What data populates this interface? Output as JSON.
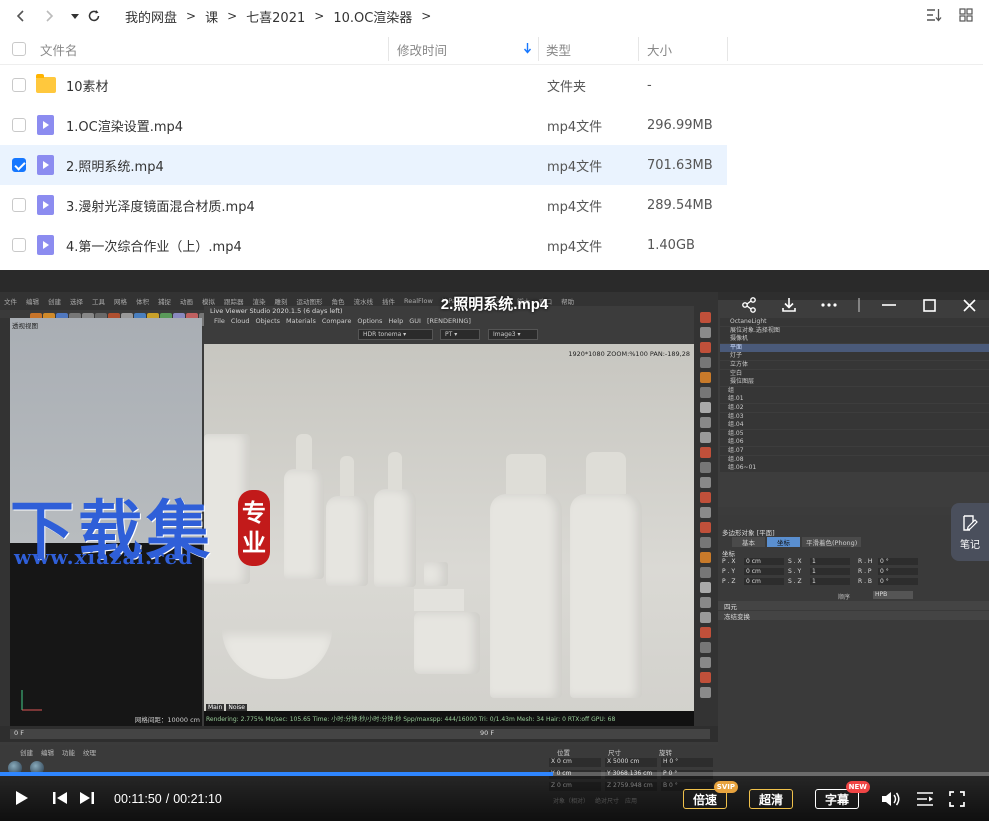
{
  "browser": {
    "breadcrumb": [
      "我的网盘",
      "课",
      "七喜2021",
      "10.OC渲染器"
    ],
    "columns": {
      "name": "文件名",
      "modified": "修改时间",
      "type": "类型",
      "size": "大小"
    },
    "files": [
      {
        "name": "10素材",
        "type": "文件夹",
        "size": "-",
        "icon": "folder-icon",
        "checked": false
      },
      {
        "name": "1.OC渲染设置.mp4",
        "type": "mp4文件",
        "size": "296.99MB",
        "icon": "video-file-icon",
        "checked": false
      },
      {
        "name": "2.照明系统.mp4",
        "type": "mp4文件",
        "size": "701.63MB",
        "icon": "video-file-icon",
        "checked": true
      },
      {
        "name": "3.漫射光泽度镜面混合材质.mp4",
        "type": "mp4文件",
        "size": "289.54MB",
        "icon": "video-file-icon",
        "checked": false
      },
      {
        "name": "4.第一次综合作业（上）.mp4",
        "type": "mp4文件",
        "size": "1.40GB",
        "icon": "video-file-icon",
        "checked": false
      }
    ]
  },
  "player": {
    "title": "2.照明系统.mp4",
    "current_time": "00:11:50",
    "total_time": "00:21:10",
    "progress_fraction": 0.5591,
    "speed_label": "倍速",
    "speed_badge": "SVIP",
    "quality_label": "超清",
    "subtitle_label": "字幕",
    "subtitle_badge": "NEW",
    "note_label": "笔记",
    "accent": "#2f86ff"
  },
  "c4d": {
    "menu": [
      "文件",
      "编辑",
      "创建",
      "选择",
      "工具",
      "网格",
      "体积",
      "捕捉",
      "动画",
      "模拟",
      "跟踪器",
      "渲染",
      "雕刻",
      "运动图形",
      "角色",
      "流水线",
      "插件",
      "RealFlow",
      "X-Particles",
      "Octane",
      "脚本",
      "窗口",
      "帮助"
    ],
    "viewport_label": "透视视图",
    "viewport_footer": "网格间距：10000 cm",
    "render_window_title": "Live Viewer Studio 2020.1.5 (6 days left)",
    "render_menu": [
      "File",
      "Cloud",
      "Objects",
      "Materials",
      "Compare",
      "Options",
      "Help",
      "GUI",
      "[RENDERING]"
    ],
    "render_info": "1920*1080 ZOOM:%100  PAN:-189,28",
    "render_status": "Rendering: 2.775%  Ms/sec: 105.65   Time: 小时:分钟:秒/小时:分钟:秒   Spp/maxspp: 444/16000  Tri: 0/1.43m   Mesh: 34   Hair: 0   RTX:off     GPU: 68",
    "render_tabs": [
      "Main",
      "Noise"
    ],
    "objects": [
      "OctaneLight",
      "展位对象.选择视图",
      "摄像机",
      "平面",
      "灯子",
      "立方体",
      "空白",
      "摄位图层",
      "组",
      "组.01",
      "组.02",
      "组.03",
      "组.04",
      "组.05",
      "组.06",
      "组.07",
      "组.08",
      "组.06~01"
    ],
    "attr_title": "多边形对象 [平面]",
    "attr_tabs": [
      "基本",
      "坐标",
      "平滑着色(Phong)"
    ],
    "coords_title": "坐标",
    "coords": [
      {
        "axis": "P . X",
        "value": "0 cm",
        "s": "S . X",
        "sval": "1",
        "r": "R . H",
        "rval": "0 °"
      },
      {
        "axis": "P . Y",
        "value": "0 cm",
        "s": "S . Y",
        "sval": "1",
        "r": "R . P",
        "rval": "0 °"
      },
      {
        "axis": "P . Z",
        "value": "0 cm",
        "s": "S . Z",
        "sval": "1",
        "r": "R . B",
        "rval": "0 °"
      }
    ],
    "order_label": "顺序",
    "order_value": "HPB",
    "quat_label": "四元",
    "freeze_label": "冻结变换",
    "timeline_start": "0 F",
    "timeline_end": "90 F",
    "mat_menu": [
      "创建",
      "编辑",
      "功能",
      "纹理"
    ],
    "xform_headers": [
      "位置",
      "尺寸",
      "旋转"
    ],
    "xform_rows": [
      {
        "pos": "X 0 cm",
        "size": "X 5000 cm",
        "rot": "H 0 °"
      },
      {
        "pos": "Y 0 cm",
        "size": "Y 3068.136 cm",
        "rot": "P 0 °"
      },
      {
        "pos": "Z 0 cm",
        "size": "Z 2759.948 cm",
        "rot": "B 0 °"
      }
    ],
    "xform_footer": [
      "对象（相对）",
      "绝对尺寸",
      "应用"
    ]
  },
  "watermark": {
    "big_text": "下载集",
    "url": "www.xiazai.red",
    "seal_text": [
      "专",
      "业"
    ],
    "color": "#2f5fd8",
    "seal_color": "#c21a1a"
  }
}
